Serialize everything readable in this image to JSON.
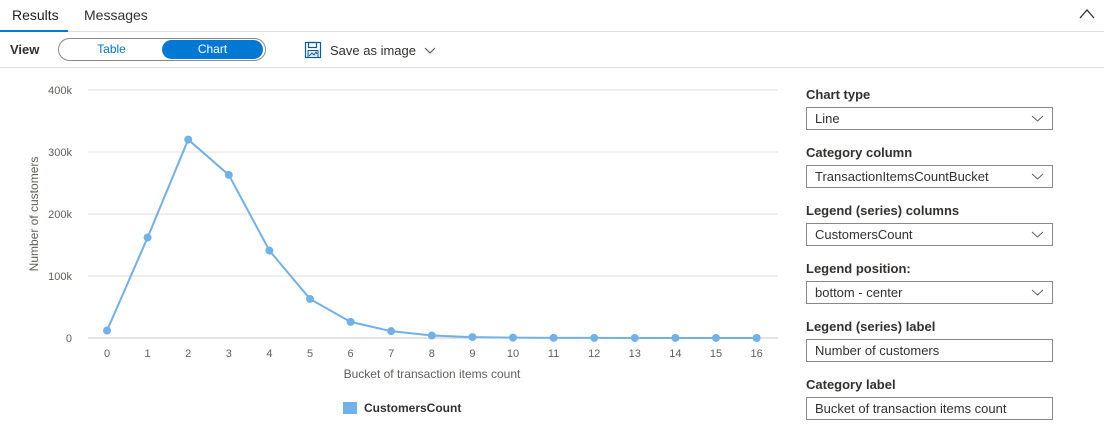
{
  "tabs": {
    "results": "Results",
    "messages": "Messages"
  },
  "toolbar": {
    "view_label": "View",
    "toggle_table": "Table",
    "toggle_chart": "Chart",
    "save_as_image": "Save as image",
    "save_icon": "save-image-icon"
  },
  "colors": {
    "accent": "#0078d4",
    "series": "#72b1e8"
  },
  "settings": {
    "chart_type_label": "Chart type",
    "chart_type_value": "Line",
    "category_column_label": "Category column",
    "category_column_value": "TransactionItemsCountBucket",
    "legend_columns_label": "Legend (series) columns",
    "legend_columns_value": "CustomersCount",
    "legend_position_label": "Legend position:",
    "legend_position_value": "bottom - center",
    "legend_label_label": "Legend (series) label",
    "legend_label_value": "Number of customers",
    "category_label_label": "Category label",
    "category_label_value": "Bucket of transaction items count"
  },
  "chart_data": {
    "type": "line",
    "x": [
      "0",
      "1",
      "2",
      "3",
      "4",
      "5",
      "6",
      "7",
      "8",
      "9",
      "10",
      "11",
      "12",
      "13",
      "14",
      "15",
      "16"
    ],
    "series": [
      {
        "name": "CustomersCount",
        "values": [
          12000,
          162000,
          320000,
          263000,
          141000,
          63000,
          26000,
          11000,
          4000,
          1500,
          600,
          300,
          150,
          80,
          50,
          30,
          20
        ]
      }
    ],
    "ylim": [
      0,
      400000
    ],
    "yticks": [
      "0",
      "100k",
      "200k",
      "300k",
      "400k"
    ],
    "ytick_values": [
      0,
      100000,
      200000,
      300000,
      400000
    ],
    "xlabel": "Bucket of transaction items count",
    "ylabel": "Number of customers",
    "legend": "bottom-center",
    "grid": true
  }
}
